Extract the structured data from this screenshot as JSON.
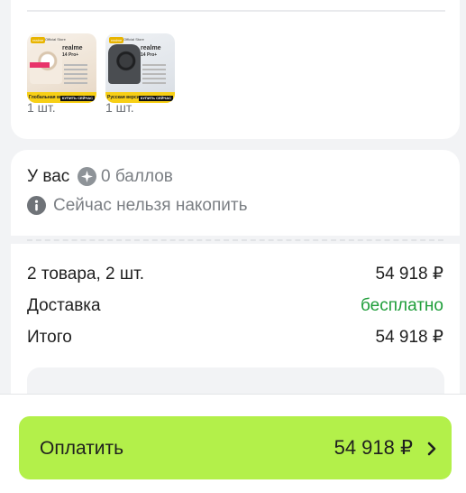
{
  "items_card": {
    "products": [
      {
        "thumb": {
          "badge": "realme",
          "store": "Official Store",
          "brand": "realme",
          "model": "14 Pro+",
          "region": "Глобальная версия",
          "buy": "КУПИТЬ СЕЙЧАС",
          "phone_color": "light"
        },
        "quantity": "1 шт."
      },
      {
        "thumb": {
          "badge": "realme",
          "store": "Official Store",
          "brand": "realme",
          "model": "14 Pro+",
          "region": "Русская версия",
          "buy": "КУПИТЬ СЕЙЧАС",
          "phone_color": "dark"
        },
        "quantity": "1 шт."
      }
    ]
  },
  "points_card": {
    "have_label": "У вас",
    "points_icon": "plus-circle-icon",
    "points_value": "0 баллов",
    "info_icon": "info-icon",
    "info_text": "Сейчас нельзя накопить"
  },
  "summary": {
    "rows": [
      {
        "label": "2 товара, 2 шт.",
        "value": "54 918 ₽"
      },
      {
        "label": "Доставка",
        "value": "бесплатно"
      },
      {
        "label": "Итого",
        "value": "54 918 ₽"
      }
    ]
  },
  "pay_button": {
    "label": "Оплатить",
    "amount": "54 918 ₽",
    "icon": "chevron-right-icon"
  },
  "colors": {
    "accent": "#b3f04a",
    "free_delivery": "#1f9e3a",
    "muted_text": "#7b7f84",
    "background": "#f2f3f5"
  }
}
